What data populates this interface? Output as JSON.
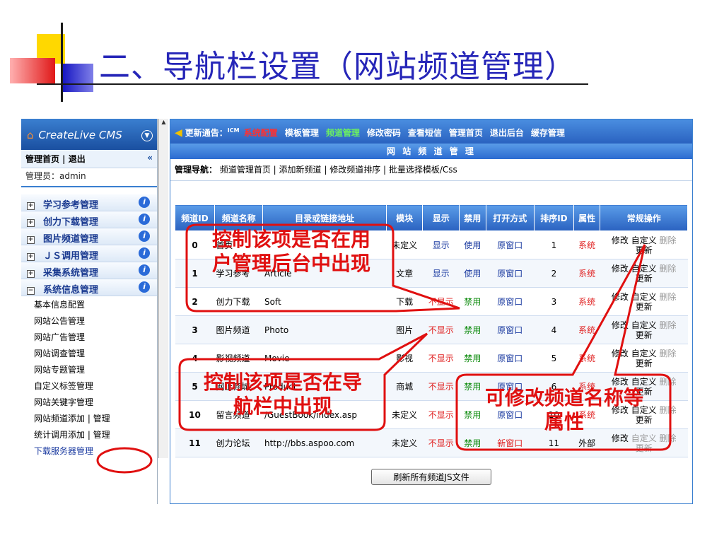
{
  "slide": {
    "title": "二、导航栏设置（网站频道管理）"
  },
  "sidebar": {
    "logo_text": "CreateLive CMS",
    "top_links": "管理首页 | 退出",
    "collapse_icon": "«",
    "admin_label": "管理员：admin",
    "sections": [
      {
        "label": "学习参考管理"
      },
      {
        "label": "创力下载管理"
      },
      {
        "label": "图片频道管理"
      },
      {
        "label": "ＪＳ调用管理"
      },
      {
        "label": "采集系统管理"
      },
      {
        "label": "系统信息管理",
        "expanded": true
      }
    ],
    "sub_items": [
      "基本信息配置",
      "网站公告管理",
      "网站广告管理",
      "网站调查管理",
      "网站专题管理",
      "自定义标签管理",
      "网站关键字管理",
      "网站频道添加 | 管理",
      "统计调用添加 | 管理",
      "下载服务器管理"
    ]
  },
  "topbar": {
    "notice": "更新通告：",
    "notice_mark": "ICM",
    "links": [
      "系统配置",
      "模板管理",
      "频道管理",
      "修改密码",
      "查看短信",
      "管理首页",
      "退出后台",
      "缓存管理"
    ]
  },
  "panel": {
    "title": "网 站 频 道 管 理",
    "nav_label": "管理导航：",
    "nav_links": "频道管理首页 | 添加新频道 | 修改频道排序 | 批量选择模板/Css"
  },
  "table": {
    "headers": [
      "频道ID",
      "频道名称",
      "目录或链接地址",
      "模块",
      "显示",
      "禁用",
      "打开方式",
      "排序ID",
      "属性",
      "常规操作"
    ],
    "rows": [
      {
        "id": "0",
        "name": "首页",
        "url": "",
        "module": "未定义",
        "show": "显示",
        "disable": "使用",
        "open": "原窗口",
        "order": "1",
        "attr": "系统"
      },
      {
        "id": "1",
        "name": "学习参考",
        "url": "Article",
        "module": "文章",
        "show": "显示",
        "disable": "使用",
        "open": "原窗口",
        "order": "2",
        "attr": "系统"
      },
      {
        "id": "2",
        "name": "创力下载",
        "url": "Soft",
        "module": "下载",
        "show": "不显示",
        "disable": "禁用",
        "open": "原窗口",
        "order": "3",
        "attr": "系统"
      },
      {
        "id": "3",
        "name": "图片频道",
        "url": "Photo",
        "module": "图片",
        "show": "不显示",
        "disable": "禁用",
        "open": "原窗口",
        "order": "4",
        "attr": "系统"
      },
      {
        "id": "4",
        "name": "影视频道",
        "url": "Movie",
        "module": "影视",
        "show": "不显示",
        "disable": "禁用",
        "open": "原窗口",
        "order": "5",
        "attr": "系统"
      },
      {
        "id": "5",
        "name": "网上商城",
        "url": "Product",
        "module": "商城",
        "show": "不显示",
        "disable": "禁用",
        "open": "原窗口",
        "order": "6",
        "attr": "系统"
      },
      {
        "id": "10",
        "name": "留言频道",
        "url": "/GuestBook/index.asp",
        "module": "未定义",
        "show": "不显示",
        "disable": "禁用",
        "open": "原窗口",
        "order": "10",
        "attr": "系统"
      },
      {
        "id": "11",
        "name": "创力论坛",
        "url": "http://bbs.aspoo.com",
        "module": "未定义",
        "show": "不显示",
        "disable": "禁用",
        "open": "新窗口",
        "order": "11",
        "attr": "外部"
      }
    ],
    "ops": {
      "edit": "修改",
      "custom": "自定义",
      "delete": "删除",
      "update": "更新"
    },
    "refresh_button": "刷新所有频道JS文件"
  },
  "annotations": {
    "callout_1": [
      "控制该项是否在用",
      "户管理后台中出现"
    ],
    "callout_2": [
      "控制该项是否在导",
      "航栏中出现"
    ],
    "callout_3": [
      "可修改频道名称等",
      "属性"
    ]
  },
  "colors": {
    "annotation": "#e01010",
    "title": "#2626b8",
    "header_blue": "#2a62c0"
  }
}
